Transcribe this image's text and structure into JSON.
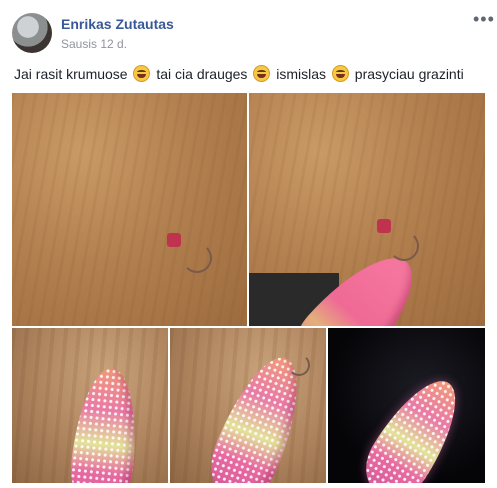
{
  "post": {
    "author": "Enrikas Zutautas",
    "date": "Sausis 12 d.",
    "menu_icon": "more-options-icon",
    "text_segments": [
      "Jai rasit krumuose",
      "tai cia drauges",
      "ismislas",
      "prasyciau grazinti"
    ],
    "emoji_icon": "grinning-emoji-icon"
  },
  "photos": {
    "count": 5,
    "subjects": [
      "pink-lure-on-wood",
      "pink-lure-on-wood",
      "studded-lure-on-wood",
      "studded-lure-on-wood",
      "studded-lure-on-dark"
    ]
  }
}
